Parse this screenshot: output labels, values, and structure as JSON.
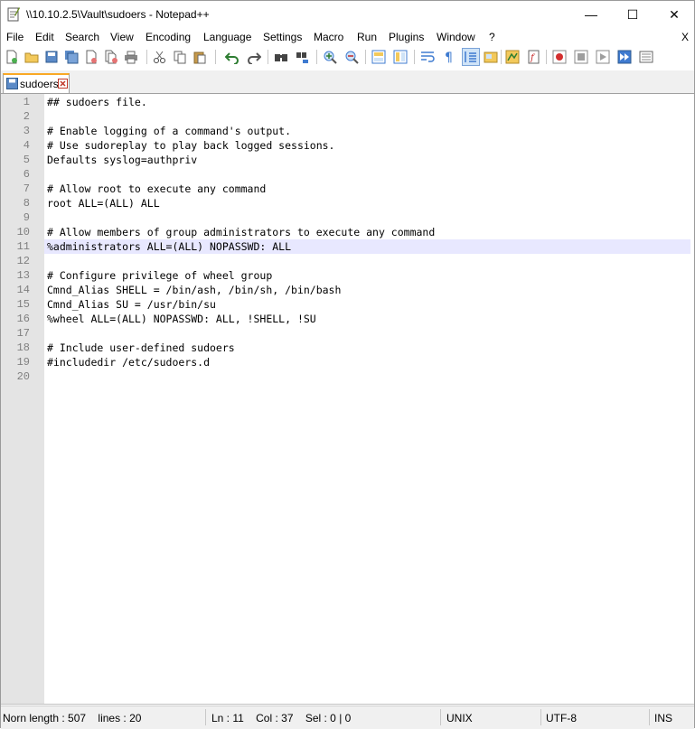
{
  "window": {
    "title": "\\\\10.10.2.5\\Vault\\sudoers - Notepad++"
  },
  "caption": {
    "minimize": "—",
    "maximize": "☐",
    "close": "✕"
  },
  "menu": [
    "File",
    "Edit",
    "Search",
    "View",
    "Encoding",
    "Language",
    "Settings",
    "Macro",
    "Run",
    "Plugins",
    "Window",
    "?"
  ],
  "menu_close": "X",
  "toolbar_icons": [
    "new-file-icon",
    "open-file-icon",
    "save-icon",
    "save-all-icon",
    "close-icon",
    "close-all-icon",
    "print-icon",
    "cut-icon",
    "copy-icon",
    "paste-icon",
    "undo-icon",
    "redo-icon",
    "find-icon",
    "replace-icon",
    "zoom-in-icon",
    "zoom-out-icon",
    "sync-vertical-icon",
    "sync-horizontal-icon",
    "word-wrap-icon",
    "show-all-chars-icon",
    "indent-guide-icon",
    "language-icon",
    "doc-map-icon",
    "function-list-icon",
    "record-macro-icon",
    "stop-macro-icon",
    "play-macro-icon",
    "run-macro-multiple-icon",
    "save-macro-icon"
  ],
  "tab": {
    "label": "sudoers"
  },
  "editor": {
    "current_line": 11,
    "lines": [
      "## sudoers file.",
      "",
      "# Enable logging of a command's output.",
      "# Use sudoreplay to play back logged sessions.",
      "Defaults syslog=authpriv",
      "",
      "# Allow root to execute any command",
      "root ALL=(ALL) ALL",
      "",
      "# Allow members of group administrators to execute any command",
      "%administrators ALL=(ALL) NOPASSWD: ALL",
      "",
      "# Configure privilege of wheel group",
      "Cmnd_Alias SHELL = /bin/ash, /bin/sh, /bin/bash",
      "Cmnd_Alias SU = /usr/bin/su",
      "%wheel ALL=(ALL) NOPASSWD: ALL, !SHELL, !SU",
      "",
      "# Include user-defined sudoers",
      "#includedir /etc/sudoers.d",
      ""
    ]
  },
  "status": {
    "length": "Norn length : 507    lines : 20",
    "position": "Ln : 11    Col : 37    Sel : 0 | 0",
    "eol": "UNIX",
    "encoding": "UTF-8",
    "mode": "INS"
  }
}
